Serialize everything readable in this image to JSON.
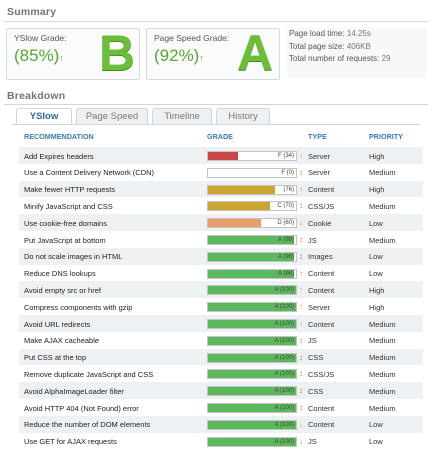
{
  "summary": {
    "title": "Summary",
    "yslow": {
      "label": "YSlow Grade:",
      "percent": "(85%)",
      "arrow": "↑",
      "letter": "B"
    },
    "pagespeed": {
      "label": "Page Speed Grade:",
      "percent": "(92%)",
      "arrow": "↑",
      "letter": "A"
    },
    "stats": [
      {
        "label": "Page load time:",
        "value": "14.25s"
      },
      {
        "label": "Total page size:",
        "value": "406KB"
      },
      {
        "label": "Total number of requests:",
        "value": "29"
      }
    ]
  },
  "breakdown": {
    "title": "Breakdown",
    "tabs": [
      "YSlow",
      "Page Speed",
      "Timeline",
      "History"
    ],
    "active_tab": 0,
    "columns": {
      "recommendation": "RECOMMENDATION",
      "grade": "GRADE",
      "type": "TYPE",
      "priority": "PRIORITY"
    },
    "rows": [
      {
        "rec": "Add Expires headers",
        "grade": "F (34)",
        "score": 34,
        "color": "#c94646",
        "icon": "↑",
        "icon_color": "#e0a020",
        "type": "Server",
        "priority": "High"
      },
      {
        "rec": "Use a Content Delivery Network (CDN)",
        "grade": "F (0)",
        "score": 0,
        "color": "#c94646",
        "icon": "↕",
        "icon_color": "#e07a20",
        "type": "Server",
        "priority": "Medium"
      },
      {
        "rec": "Make fewer HTTP requests",
        "grade": "(76)",
        "score": 76,
        "color": "#c9a531",
        "icon": "↑",
        "icon_color": "#e0a020",
        "type": "Content",
        "priority": "High"
      },
      {
        "rec": "Minify JavaScript and CSS",
        "grade": "C (70)",
        "score": 70,
        "color": "#c9a531",
        "icon": "↕",
        "icon_color": "#e07a20",
        "type": "CSS/JS",
        "priority": "Medium"
      },
      {
        "rec": "Use cookie-free domains",
        "grade": "D (60)",
        "score": 60,
        "color": "#e6a065",
        "icon": "↓",
        "icon_color": "#e0a020",
        "type": "Cookie",
        "priority": "Low"
      },
      {
        "rec": "Put JavaScript at bottom",
        "grade": "A (98)",
        "score": 98,
        "color": "#5cb85c",
        "icon": "↕",
        "icon_color": "#e07a20",
        "type": "JS",
        "priority": "Medium"
      },
      {
        "rec": "Do not scale images in HTML",
        "grade": "A (98)",
        "score": 98,
        "color": "#5cb85c",
        "icon": "↕",
        "icon_color": "#e07a20",
        "type": "Images",
        "priority": "Low"
      },
      {
        "rec": "Reduce DNS lookups",
        "grade": "A (98)",
        "score": 98,
        "color": "#5cb85c",
        "icon": "↑",
        "icon_color": "#e0a020",
        "type": "Content",
        "priority": "Low"
      },
      {
        "rec": "Avoid empty src or href",
        "grade": "A (100)",
        "score": 100,
        "color": "#5cb85c",
        "icon": "↑",
        "icon_color": "#e0a020",
        "type": "Content",
        "priority": "High"
      },
      {
        "rec": "Compress components with gzip",
        "grade": "A (100)",
        "score": 100,
        "color": "#5cb85c",
        "icon": "↑",
        "icon_color": "#e0a020",
        "type": "Server",
        "priority": "High"
      },
      {
        "rec": "Avoid URL redirects",
        "grade": "A (100)",
        "score": 100,
        "color": "#5cb85c",
        "icon": "↑",
        "icon_color": "#e0a020",
        "type": "Content",
        "priority": "Medium"
      },
      {
        "rec": "Make AJAX cacheable",
        "grade": "A (100)",
        "score": 100,
        "color": "#5cb85c",
        "icon": "↕",
        "icon_color": "#e07a20",
        "type": "JS",
        "priority": "Medium"
      },
      {
        "rec": "Put CSS at the top",
        "grade": "A (100)",
        "score": 100,
        "color": "#5cb85c",
        "icon": "↕",
        "icon_color": "#e07a20",
        "type": "CSS",
        "priority": "Medium"
      },
      {
        "rec": "Remove duplicate JavaScript and CSS",
        "grade": "A (100)",
        "score": 100,
        "color": "#5cb85c",
        "icon": "↕",
        "icon_color": "#e07a20",
        "type": "CSS/JS",
        "priority": "Medium"
      },
      {
        "rec": "Avoid AlphaImageLoader filter",
        "grade": "A (100)",
        "score": 100,
        "color": "#5cb85c",
        "icon": "↕",
        "icon_color": "#e07a20",
        "type": "CSS",
        "priority": "Medium"
      },
      {
        "rec": "Avoid HTTP 404 (Not Found) error",
        "grade": "A (100)",
        "score": 100,
        "color": "#5cb85c",
        "icon": "↕",
        "icon_color": "#e07a20",
        "type": "Content",
        "priority": "Medium"
      },
      {
        "rec": "Reduce the number of DOM elements",
        "grade": "A (100)",
        "score": 100,
        "color": "#5cb85c",
        "icon": "↓",
        "icon_color": "#e0a020",
        "type": "Content",
        "priority": "Low"
      },
      {
        "rec": "Use GET for AJAX requests",
        "grade": "A (100)",
        "score": 100,
        "color": "#5cb85c",
        "icon": "↓",
        "icon_color": "#e0a020",
        "type": "JS",
        "priority": "Low"
      }
    ]
  }
}
